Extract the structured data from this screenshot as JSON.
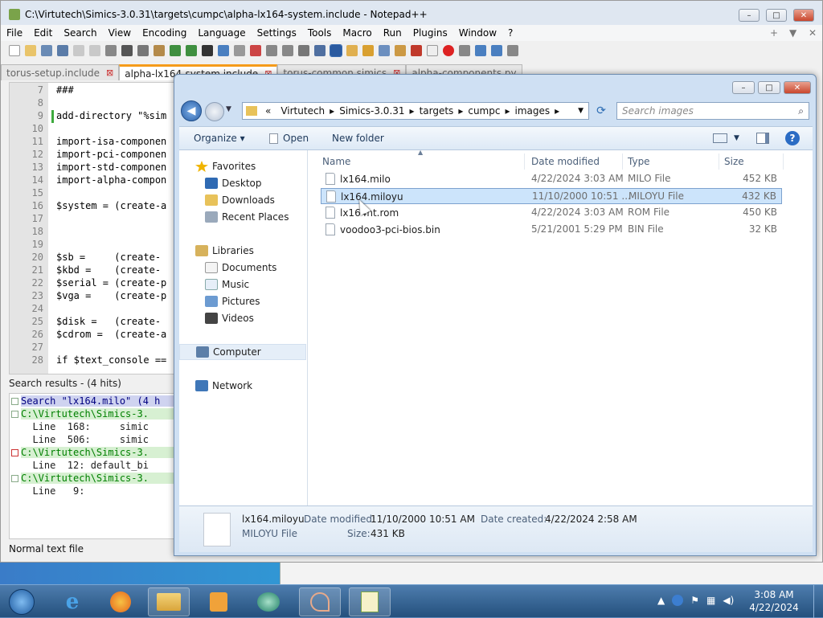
{
  "npp": {
    "title": "C:\\Virtutech\\Simics-3.0.31\\targets\\cumpc\\alpha-lx164-system.include - Notepad++",
    "menu": [
      "File",
      "Edit",
      "Search",
      "View",
      "Encoding",
      "Language",
      "Settings",
      "Tools",
      "Macro",
      "Run",
      "Plugins",
      "Window",
      "?"
    ],
    "tabs": [
      "torus-setup.include",
      "alpha-lx164-system.include",
      "torus-common.simics",
      "alpha-components.py"
    ],
    "lines": [
      {
        "n": "7",
        "code": "###"
      },
      {
        "n": "8",
        "code": ""
      },
      {
        "n": "9",
        "code": "add-directory \"%sim"
      },
      {
        "n": "10",
        "code": ""
      },
      {
        "n": "11",
        "code": "import-isa-componen"
      },
      {
        "n": "12",
        "code": "import-pci-componen"
      },
      {
        "n": "13",
        "code": "import-std-componen"
      },
      {
        "n": "14",
        "code": "import-alpha-compon"
      },
      {
        "n": "15",
        "code": ""
      },
      {
        "n": "16",
        "code": "$system = (create-a"
      },
      {
        "n": "17",
        "code": ""
      },
      {
        "n": "18",
        "code": ""
      },
      {
        "n": "19",
        "code": ""
      },
      {
        "n": "20",
        "code": "$sb =     (create-"
      },
      {
        "n": "21",
        "code": "$kbd =    (create-"
      },
      {
        "n": "22",
        "code": "$serial = (create-p"
      },
      {
        "n": "23",
        "code": "$vga =    (create-p"
      },
      {
        "n": "24",
        "code": ""
      },
      {
        "n": "25",
        "code": "$disk =   (create-"
      },
      {
        "n": "26",
        "code": "$cdrom =  (create-a"
      },
      {
        "n": "27",
        "code": ""
      },
      {
        "n": "28",
        "code": "if $text_console =="
      }
    ],
    "search_header": "Search results - (4 hits)",
    "search_results": [
      {
        "text": "Search \"lx164.milo\" (4 h",
        "kind": "query"
      },
      {
        "text": "C:\\Virtutech\\Simics-3.",
        "kind": "file"
      },
      {
        "text": "  Line  168:     simic",
        "kind": "hit"
      },
      {
        "text": "  Line  506:     simic",
        "kind": "hit"
      },
      {
        "text": "C:\\Virtutech\\Simics-3.",
        "kind": "file"
      },
      {
        "text": "  Line  12: default_bi",
        "kind": "hit"
      },
      {
        "text": "C:\\Virtutech\\Simics-3.",
        "kind": "file"
      },
      {
        "text": "  Line   9:",
        "kind": "hit"
      }
    ],
    "status": "Normal text file"
  },
  "explorer": {
    "breadcrumb": [
      "«",
      "Virtutech",
      "Simics-3.0.31",
      "targets",
      "cumpc",
      "images"
    ],
    "search_placeholder": "Search images",
    "commands": {
      "organize": "Organize ▾",
      "open": "Open",
      "new_folder": "New folder"
    },
    "nav": [
      {
        "label": "Favorites",
        "group": true
      },
      {
        "label": "Desktop"
      },
      {
        "label": "Downloads"
      },
      {
        "label": "Recent Places"
      },
      {
        "label": "Libraries",
        "group": true
      },
      {
        "label": "Documents"
      },
      {
        "label": "Music"
      },
      {
        "label": "Pictures"
      },
      {
        "label": "Videos"
      },
      {
        "label": "Computer",
        "group": true
      },
      {
        "label": "Network",
        "group": true
      }
    ],
    "columns": [
      "Name",
      "Date modified",
      "Type",
      "Size"
    ],
    "files": [
      {
        "name": "lx164.milo",
        "date": "4/22/2024 3:03 AM",
        "type": "MILO File",
        "size": "452 KB"
      },
      {
        "name": "lx164.miloyu",
        "date": "11/10/2000 10:51 ...",
        "type": "MILOYU File",
        "size": "432 KB"
      },
      {
        "name": "lx164nt.rom",
        "date": "4/22/2024 3:03 AM",
        "type": "ROM File",
        "size": "450 KB"
      },
      {
        "name": "voodoo3-pci-bios.bin",
        "date": "5/21/2001 5:29 PM",
        "type": "BIN File",
        "size": "32 KB"
      }
    ],
    "details": {
      "name": "lx164.miloyu",
      "type": "MILOYU File",
      "modified_label": "Date modified:",
      "modified": "11/10/2000 10:51 AM",
      "created_label": "Date created:",
      "created": "4/22/2024 2:58 AM",
      "size_label": "Size:",
      "size": "431 KB"
    }
  },
  "taskbar": {
    "time": "3:08 AM",
    "date": "4/22/2024"
  }
}
